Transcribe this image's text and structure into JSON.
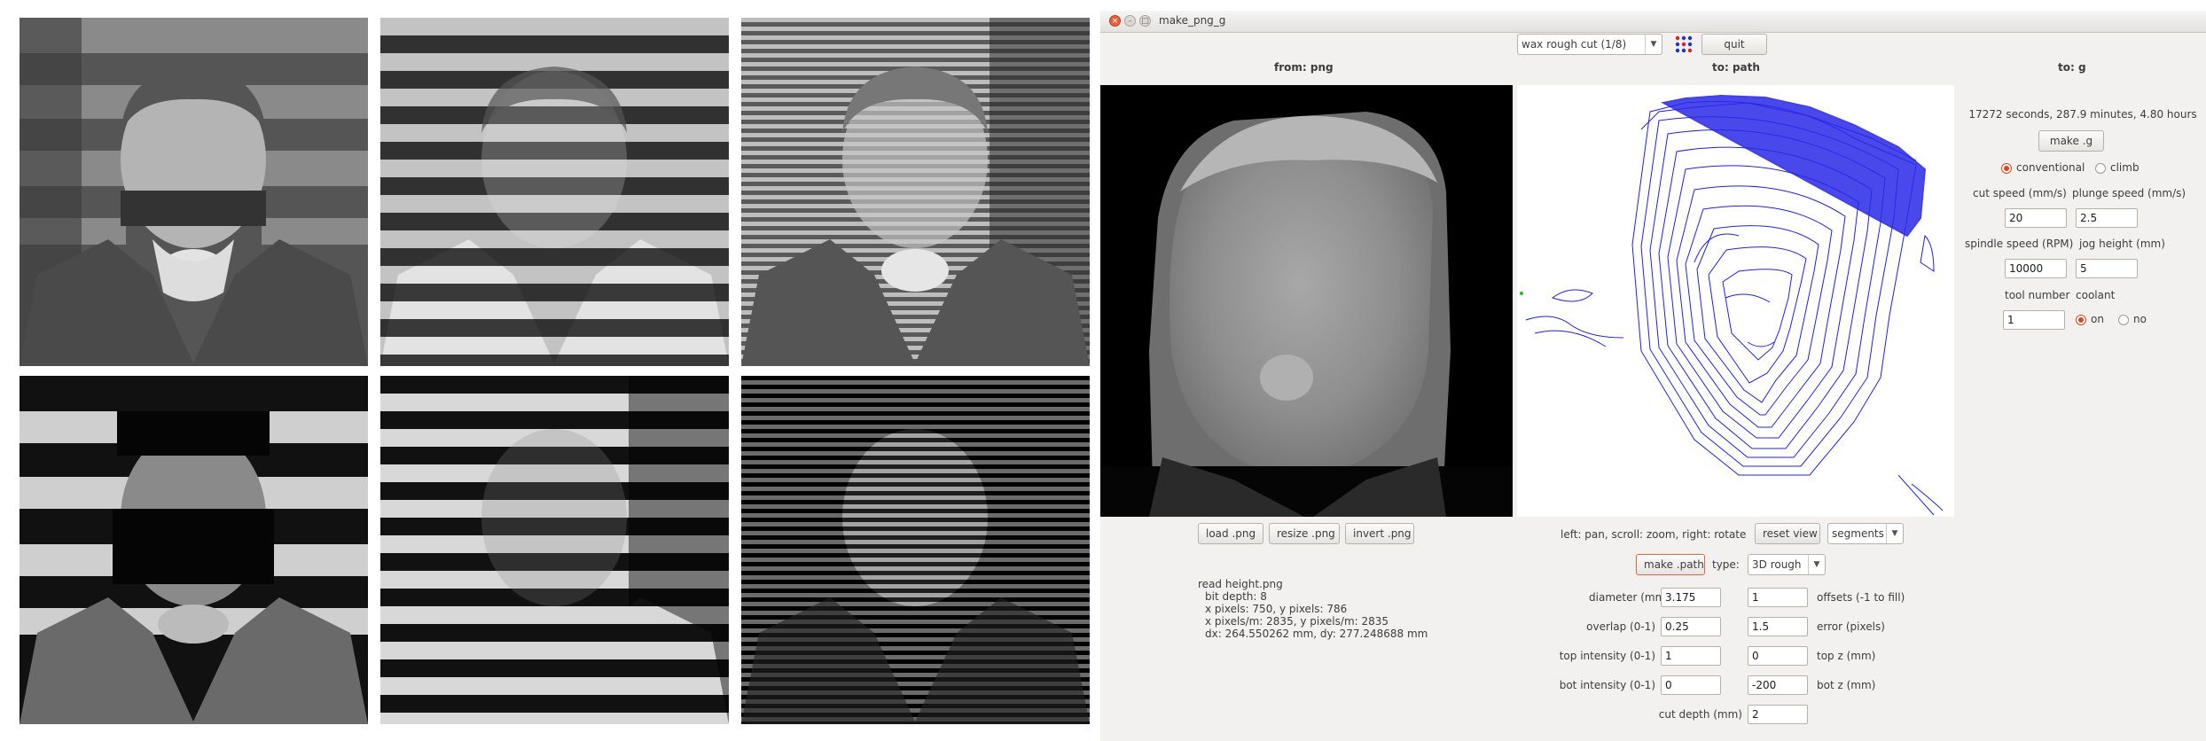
{
  "window": {
    "title": "make_png_g",
    "process_select": "wax rough cut (1/8)",
    "quit_label": "quit"
  },
  "columns": {
    "from": "from: png",
    "path": "to: path",
    "g": "to: g"
  },
  "png_panel": {
    "load_label": "load .png",
    "resize_label": "resize .png",
    "invert_label": "invert .png",
    "info": [
      "read height.png",
      "bit depth: 8",
      "x pixels: 750, y pixels: 786",
      "x pixels/m: 2835, y pixels/m: 2835",
      "dx: 264.550262 mm, dy: 277.248688 mm"
    ]
  },
  "path_panel": {
    "hint": "left: pan, scroll: zoom, right: rotate",
    "reset_view_label": "reset view",
    "view_select": "segments",
    "make_path_label": "make .path",
    "type_label": "type:",
    "type_select": "3D rough",
    "fields": {
      "diameter_label": "diameter (mm)",
      "diameter_value": "3.175",
      "offsets_label": "offsets (-1 to fill)",
      "offsets_value": "1",
      "overlap_label": "overlap (0-1)",
      "overlap_value": "0.25",
      "error_label": "error (pixels)",
      "error_value": "1.5",
      "top_intensity_label": "top intensity (0-1)",
      "top_intensity_value": "1",
      "top_z_label": "top z (mm)",
      "top_z_value": "0",
      "bot_intensity_label": "bot intensity (0-1)",
      "bot_intensity_value": "0",
      "bot_z_label": "bot z (mm)",
      "bot_z_value": "-200",
      "cut_depth_label": "cut depth (mm)",
      "cut_depth_value": "2"
    }
  },
  "g_panel": {
    "estimate": "17272 seconds, 287.9 minutes, 4.80 hours",
    "make_g_label": "make .g",
    "conventional_label": "conventional",
    "climb_label": "climb",
    "milling_mode": "conventional",
    "cut_speed_label": "cut speed (mm/s)",
    "cut_speed_value": "20",
    "plunge_speed_label": "plunge speed (mm/s)",
    "plunge_speed_value": "2.5",
    "spindle_speed_label": "spindle speed (RPM)",
    "spindle_speed_value": "10000",
    "jog_height_label": "jog height (mm)",
    "jog_height_value": "5",
    "tool_number_label": "tool number",
    "tool_number_value": "1",
    "coolant_label": "coolant",
    "coolant_on_label": "on",
    "coolant_no_label": "no",
    "coolant_mode": "on"
  },
  "colors": {
    "accent": "#d24a1f",
    "toolpath": "#2020e0"
  }
}
